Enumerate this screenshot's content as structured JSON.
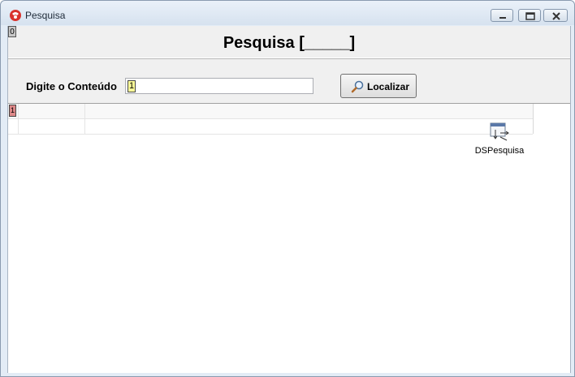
{
  "window": {
    "title": "Pesquisa"
  },
  "header": {
    "title": "Pesquisa [_____]",
    "corner_glyph": "0"
  },
  "search": {
    "label": "Digite o Conteúdo",
    "value": "1",
    "button_label": "Localizar"
  },
  "grid": {
    "header_indicator": "1",
    "rows": [
      [
        "",
        ""
      ]
    ]
  },
  "components": {
    "dataset_label": "DSPesquisa"
  },
  "colors": {
    "title_bar": "#d6e2ef",
    "client_bg": "#f0f0f0",
    "grid_bg": "#ffffff"
  }
}
